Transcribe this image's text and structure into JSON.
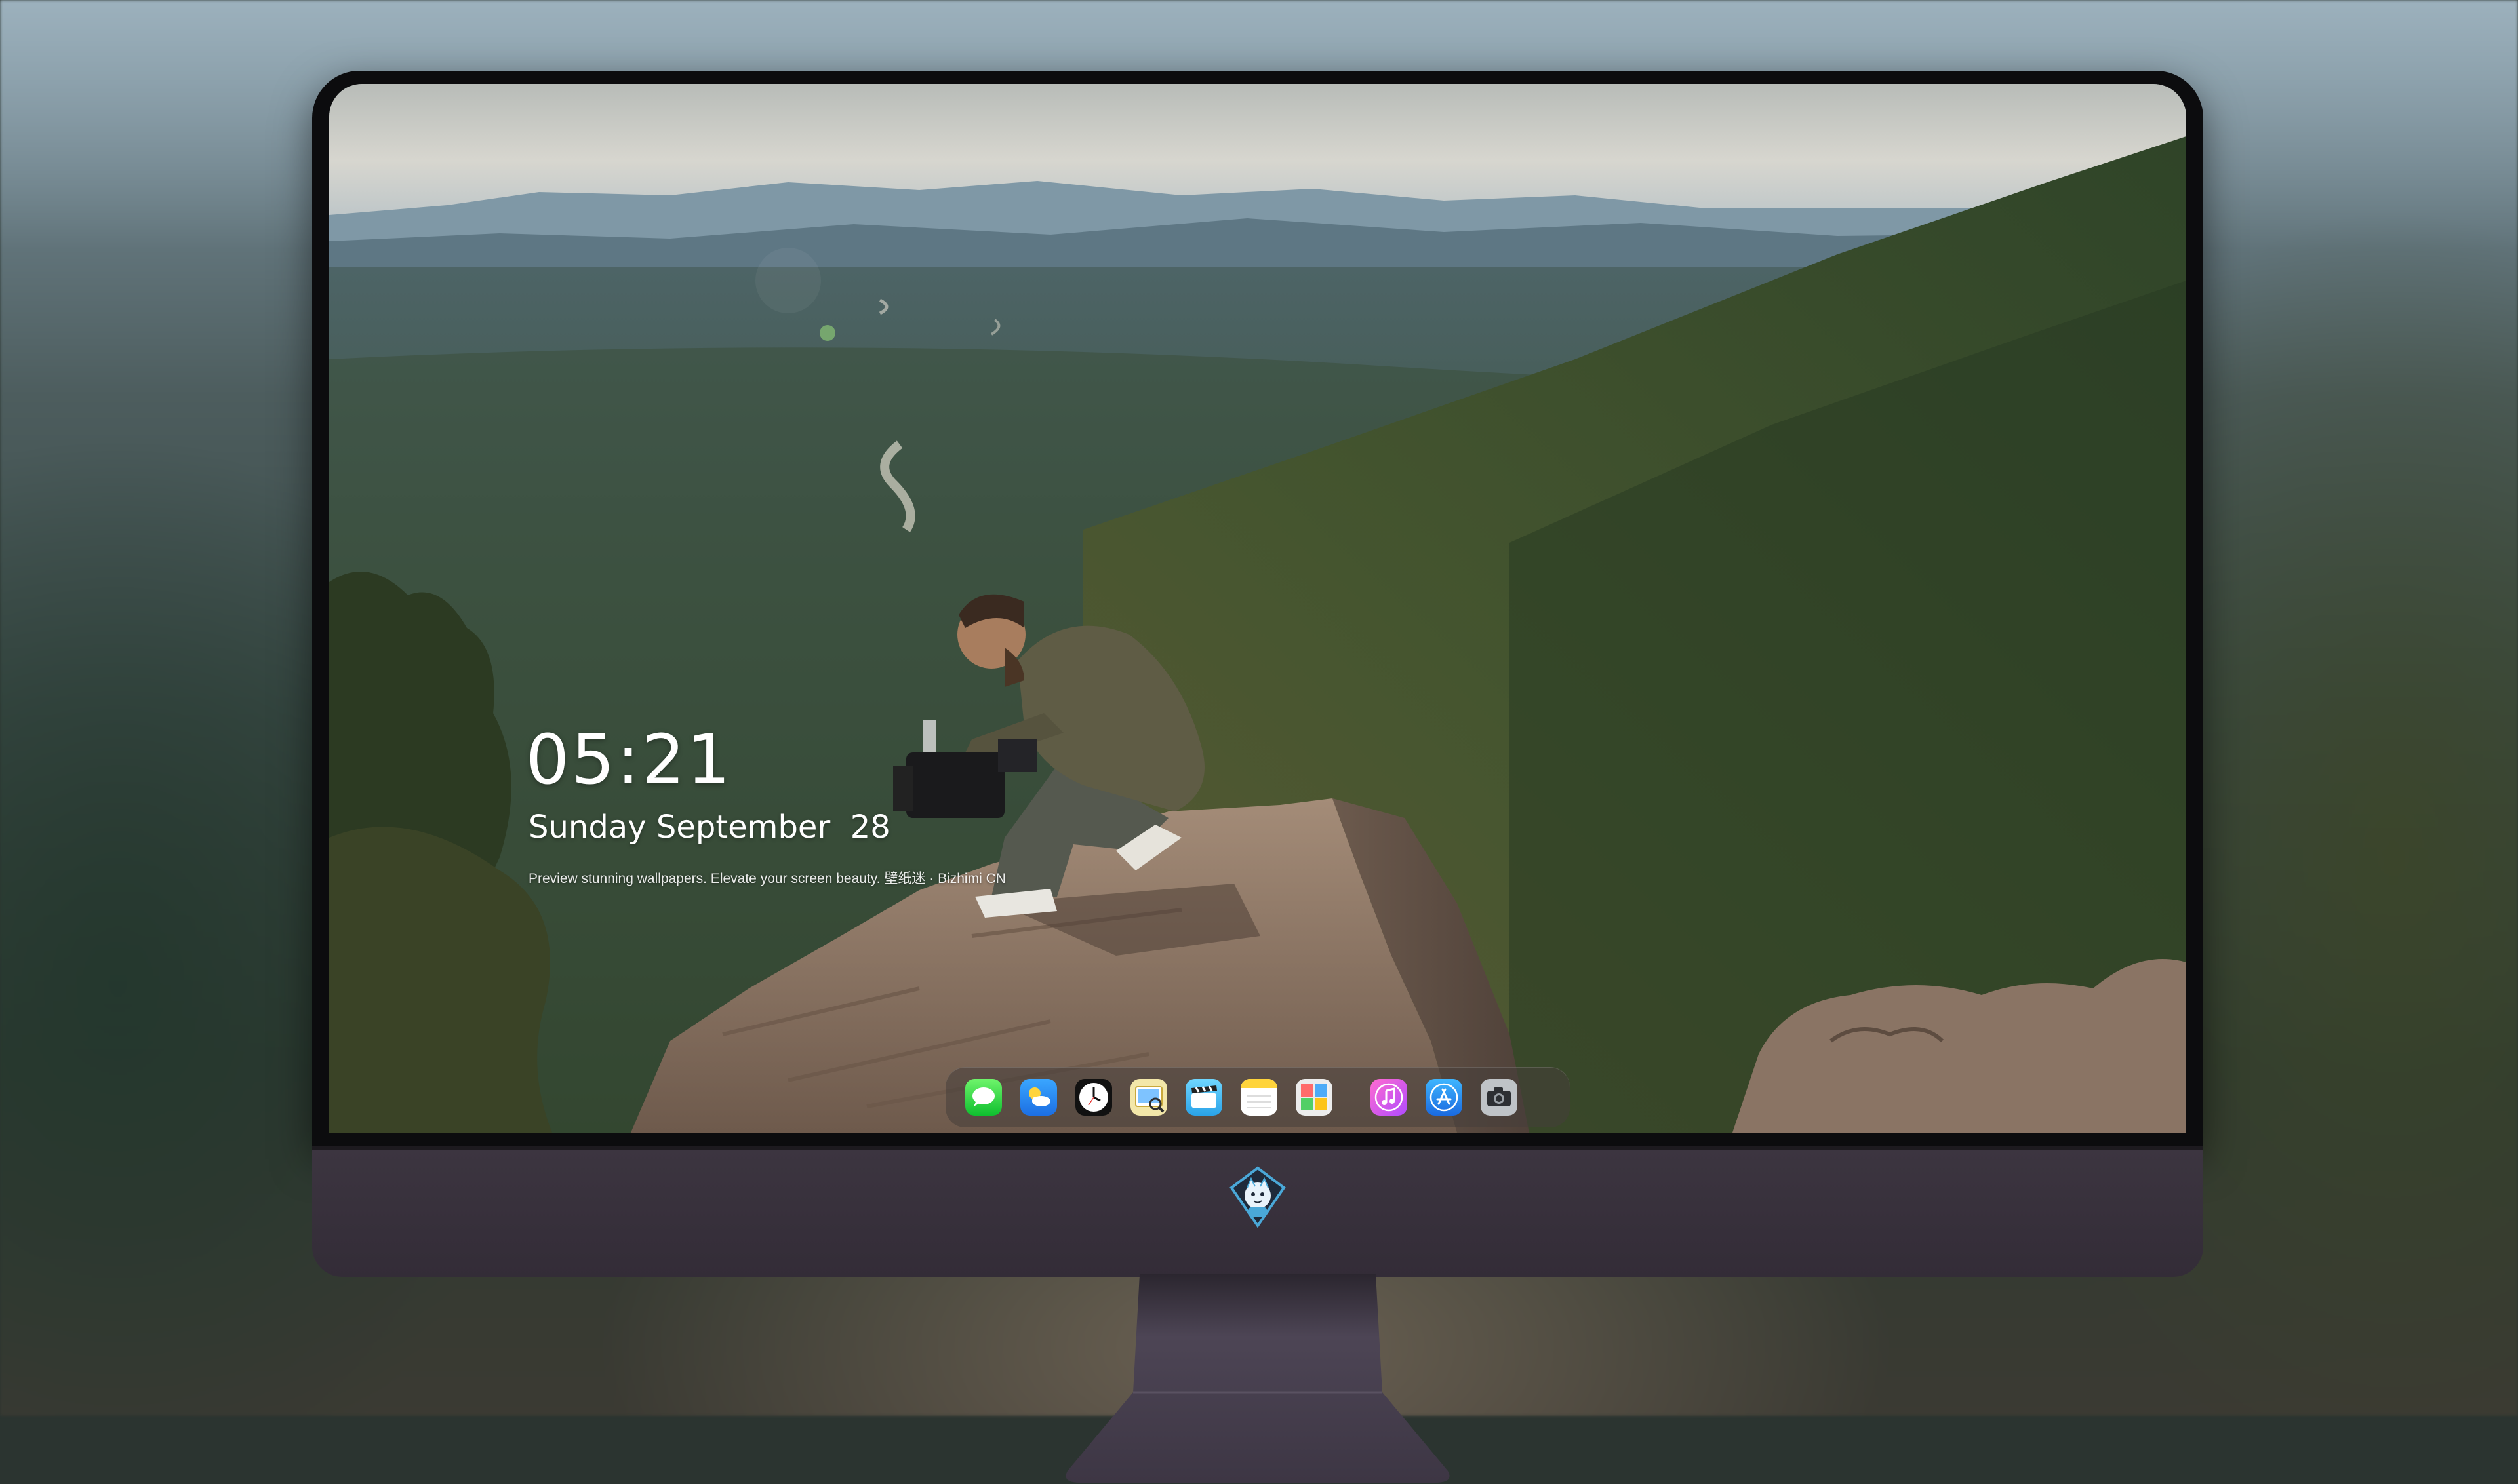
{
  "lockscreen": {
    "time": "05:21",
    "date": "Sunday September  28",
    "tagline": "Preview stunning wallpapers. Elevate your screen beauty. 壁纸迷 · Bizhimi CN"
  },
  "dock": {
    "apps": [
      {
        "name": "Messages",
        "icon": "messages-icon"
      },
      {
        "name": "Weather",
        "icon": "weather-icon"
      },
      {
        "name": "Clock",
        "icon": "clock-icon"
      },
      {
        "name": "Preview",
        "icon": "preview-icon"
      },
      {
        "name": "Clips",
        "icon": "clips-icon"
      },
      {
        "name": "Notes",
        "icon": "notes-icon"
      },
      {
        "name": "Photo Booth",
        "icon": "photo-booth-icon"
      },
      {
        "name": "iTunes",
        "icon": "music-icon"
      },
      {
        "name": "App Store",
        "icon": "app-store-icon"
      },
      {
        "name": "Camera",
        "icon": "camera-icon"
      }
    ]
  },
  "colors": {
    "bezel": "#0c0c0e",
    "chin": "#3c3540",
    "stand": "#4a4350",
    "sky": "#b9c3c7",
    "forest": "#3a4d2c",
    "rock": "#8a7564"
  }
}
